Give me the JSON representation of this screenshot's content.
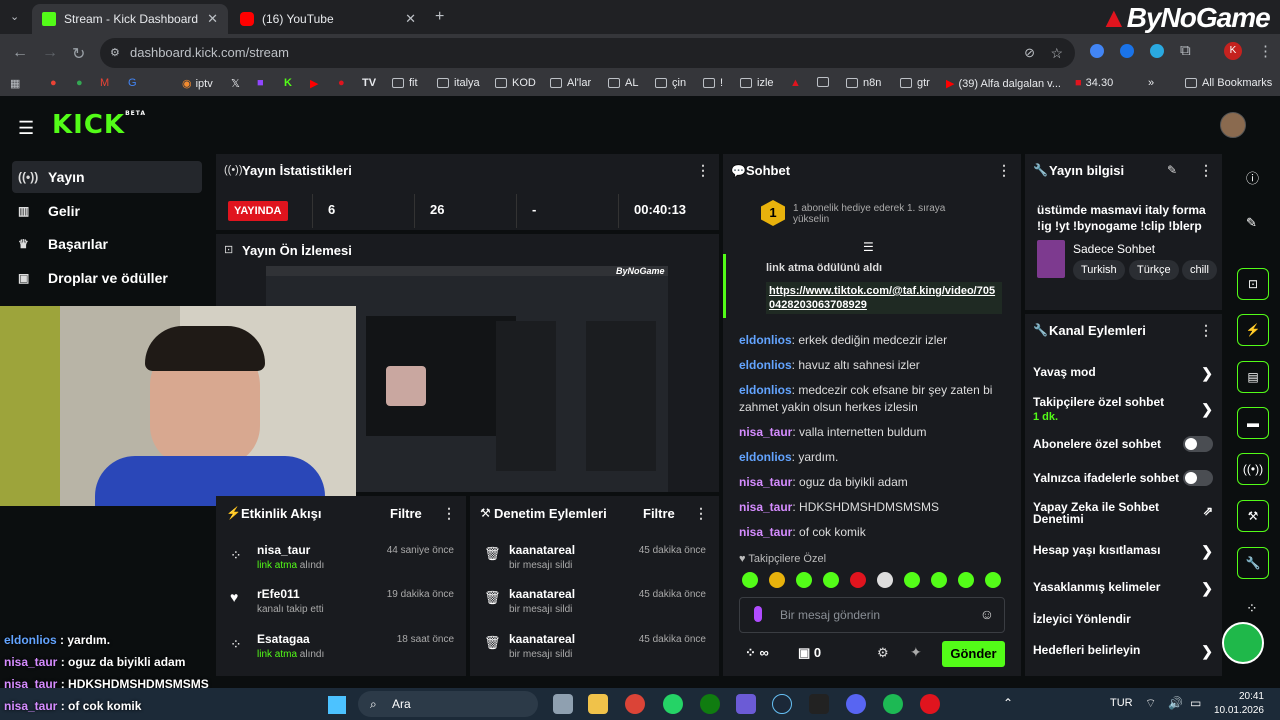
{
  "browser": {
    "tabs": [
      {
        "title": "Stream - Kick Dashboard",
        "active": true
      },
      {
        "title": "(16) YouTube",
        "active": false
      }
    ],
    "new_tab": "+",
    "url": "dashboard.kick.com/stream",
    "bookmarks": [
      "iptv",
      "fit",
      "italya",
      "KOD",
      "Al'lar",
      "AL",
      "çin",
      "!",
      "izle",
      "n8n",
      "gtr",
      "(39) Alfa dalgalan v...",
      "34.30",
      "All Bookmarks"
    ]
  },
  "watermark": "ByNoGame",
  "kick": {
    "logo": "KICK",
    "beta": "BETA",
    "sidebar": [
      "Yayın",
      "Gelir",
      "Başarılar",
      "Droplar ve ödüller"
    ],
    "stats": {
      "title": "Yayın İstatistikleri",
      "live_badge": "YAYINDA",
      "values": [
        "6",
        "26",
        "-",
        "00:40:13"
      ]
    },
    "preview": {
      "title": "Yayın Ön İzlemesi"
    },
    "activity": {
      "title": "Etkinlik Akışı",
      "filter": "Filtre",
      "rows": [
        {
          "name": "nisa_taur",
          "sub": "link atma alındı",
          "sub_highlight": "link atma",
          "sub_rest": " alındı",
          "time": "44 saniye önce"
        },
        {
          "name": "rEfe011",
          "sub": "kanalı takip etti",
          "time": "19 dakika önce"
        },
        {
          "name": "Esatagaa",
          "sub": "link atma alındı",
          "sub_highlight": "link atma",
          "sub_rest": " alındı",
          "time": "18 saat önce"
        }
      ]
    },
    "moderation": {
      "title": "Denetim Eylemleri",
      "filter": "Filtre",
      "rows": [
        {
          "name": "kaanatareal",
          "sub": "bir mesajı sildi",
          "time": "45 dakika önce"
        },
        {
          "name": "kaanatareal",
          "sub": "bir mesajı sildi",
          "time": "45 dakika önce"
        },
        {
          "name": "kaanatareal",
          "sub": "bir mesajı sildi",
          "time": "45 dakika önce"
        }
      ]
    },
    "chat": {
      "title": "Sohbet",
      "pinned": "1 abonelik hediye ederek 1. sıraya yükselin",
      "pinned_rank": "1",
      "reward": "link atma ödülünü aldı",
      "link": "https://www.tiktok.com/@taf.king/video/7050428203063708929",
      "messages": [
        {
          "user": "eldonlios",
          "color": "blue",
          "text": ": erkek dediğin medcezir izler"
        },
        {
          "user": "eldonlios",
          "color": "blue",
          "text": ": havuz altı sahnesi izler"
        },
        {
          "user": "eldonlios",
          "color": "blue",
          "text": ": medcezir cok efsane bir şey zaten bi zahmet yakin olsun herkes izlesin"
        },
        {
          "user": "nisa_taur",
          "color": "purple",
          "text": ": valla internetten buldum"
        },
        {
          "user": "eldonlios",
          "color": "blue",
          "text": ": yardım."
        },
        {
          "user": "nisa_taur",
          "color": "purple",
          "text": ": oguz da biyikli adam"
        },
        {
          "user": "nisa_taur",
          "color": "purple",
          "text": ": HDKSHDMSHDMSMSMS"
        },
        {
          "user": "nisa_taur",
          "color": "purple",
          "text": ": of cok komik"
        }
      ],
      "follower_only": "Takipçilere Özel",
      "input_placeholder": "Bir mesaj gönderin",
      "infinity": "∞",
      "count": "0",
      "send": "Gönder"
    },
    "stream_info": {
      "title": "Yayın bilgisi",
      "stream_title": "üstümde masmavi italy forma !ig !yt !bynogame !clip !blerp",
      "category": "Sadece Sohbet",
      "tags": [
        "Turkish",
        "Türkçe",
        "chill"
      ]
    },
    "channel_actions": {
      "title": "Kanal Eylemleri",
      "items": [
        {
          "label": "Yavaş mod",
          "control": "chevron"
        },
        {
          "label": "Takipçilere özel sohbet",
          "sub": "1 dk.",
          "control": "chevron"
        },
        {
          "label": "Abonelere özel sohbet",
          "control": "toggle"
        },
        {
          "label": "Yalnızca ifadelerle sohbet",
          "control": "toggle"
        },
        {
          "label": "Yapay Zeka ile Sohbet Denetimi",
          "control": "external"
        },
        {
          "label": "Hesap yaşı kısıtlaması",
          "control": "chevron"
        },
        {
          "label": "Yasaklanmış kelimeler",
          "control": "chevron"
        },
        {
          "label": "İzleyici Yönlendir",
          "control": "none"
        },
        {
          "label": "Hedefleri belirleyin",
          "control": "chevron"
        }
      ]
    }
  },
  "overlay_chat": [
    {
      "user": "eldonlios",
      "text": "yardım."
    },
    {
      "user": "nisa_taur",
      "text": "oguz da biyikli adam"
    },
    {
      "user": "nisa_taur",
      "text": "HDKSHDMSHDMSMSMS"
    },
    {
      "user": "nisa_taur",
      "text": "of cok komik"
    }
  ],
  "taskbar": {
    "search": "Ara",
    "lang": "TUR",
    "time": "20:41",
    "date": "10.01.2026"
  },
  "colors": {
    "kick_green": "#53fc18",
    "live_red": "#e0141e",
    "user_blue": "#63a4ff",
    "user_purple": "#d58cff"
  }
}
